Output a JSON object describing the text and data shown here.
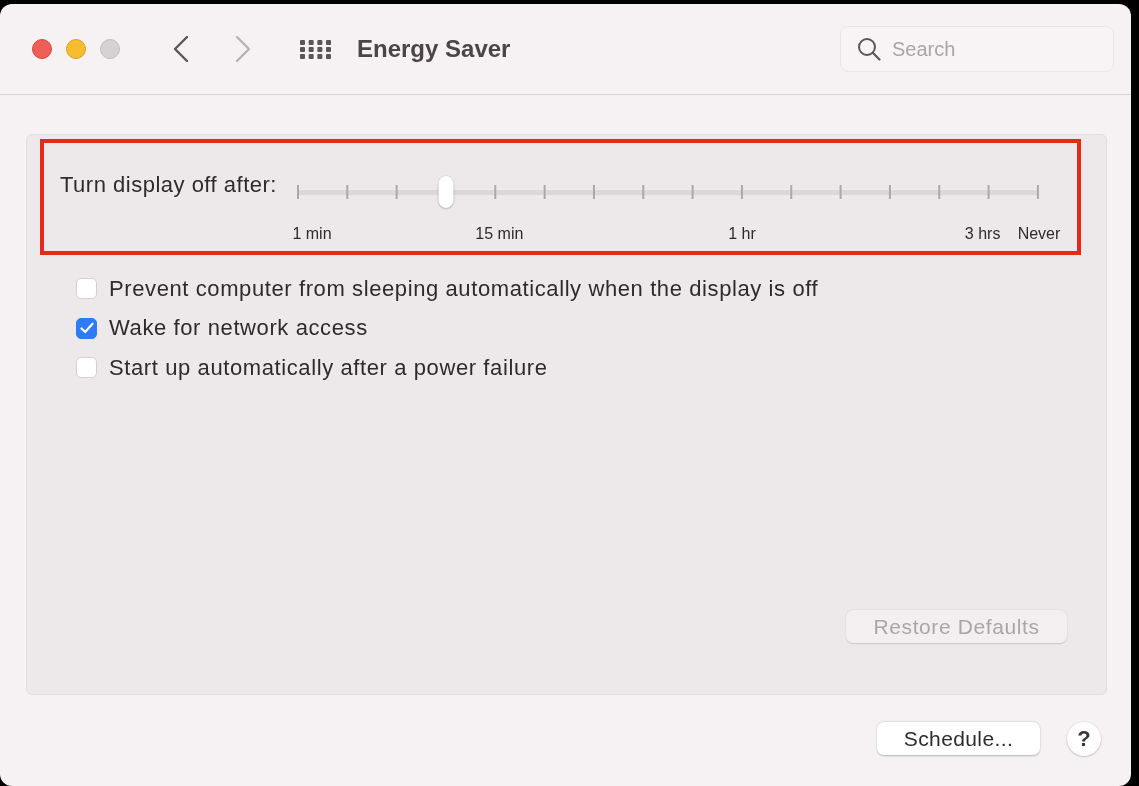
{
  "window": {
    "title": "Energy Saver",
    "controls": [
      {
        "kind": "close",
        "disabled": false
      },
      {
        "kind": "minimize",
        "disabled": false
      },
      {
        "kind": "zoom",
        "disabled": true
      }
    ]
  },
  "navigation": {
    "back": {
      "disabled": false
    },
    "forward": {
      "disabled": true
    }
  },
  "search": {
    "placeholder": "Search"
  },
  "display_sleep": {
    "label": "Turn display off after:",
    "level": 0.2,
    "highlighted": true,
    "scale_labels": [
      "1 min",
      "15 min",
      "1 hr",
      "3 hrs",
      "Never"
    ]
  },
  "options": [
    {
      "label": "Prevent computer from sleeping automatically when the display is off",
      "checked": false
    },
    {
      "label": "Wake for network access",
      "checked": true
    },
    {
      "label": "Start up automatically after a power failure",
      "checked": false
    }
  ],
  "restore_defaults": {
    "label": "Restore Defaults",
    "disabled": true
  },
  "footer": {
    "schedule": {
      "label": "Schedule..."
    },
    "help": {
      "label": "?"
    }
  }
}
